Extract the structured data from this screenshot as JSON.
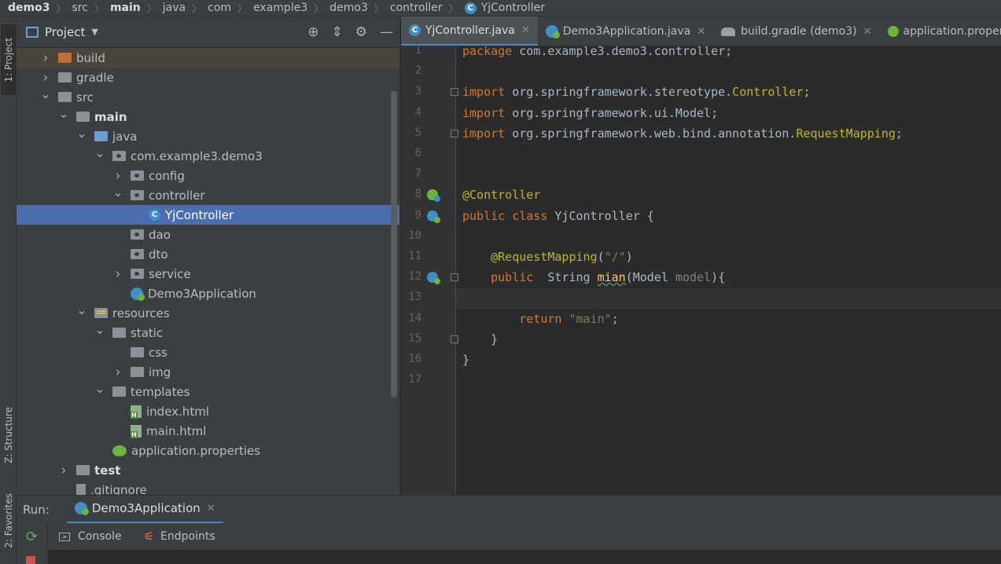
{
  "breadcrumb": [
    "demo3",
    "src",
    "main",
    "java",
    "com",
    "example3",
    "demo3",
    "controller",
    "YjController"
  ],
  "left_stripe": {
    "project": "1: Project",
    "structure": "Z: Structure",
    "favorites": "2: Favorites"
  },
  "project_panel": {
    "title": "Project",
    "tree": [
      {
        "label": "build",
        "indent": 0,
        "chev": "right",
        "icon": "folder-orange"
      },
      {
        "label": "gradle",
        "indent": 0,
        "chev": "right",
        "icon": "folder"
      },
      {
        "label": "src",
        "indent": 0,
        "chev": "down",
        "icon": "folder"
      },
      {
        "label": "main",
        "indent": 1,
        "chev": "down",
        "icon": "folder-src",
        "bold": true
      },
      {
        "label": "java",
        "indent": 2,
        "chev": "down",
        "icon": "folder-blue"
      },
      {
        "label": "com.example3.demo3",
        "indent": 3,
        "chev": "down",
        "icon": "package"
      },
      {
        "label": "config",
        "indent": 4,
        "chev": "right",
        "icon": "package"
      },
      {
        "label": "controller",
        "indent": 4,
        "chev": "down",
        "icon": "package"
      },
      {
        "label": "YjController",
        "indent": 5,
        "chev": "none",
        "icon": "class",
        "selected": true
      },
      {
        "label": "dao",
        "indent": 4,
        "chev": "none",
        "icon": "package"
      },
      {
        "label": "dto",
        "indent": 4,
        "chev": "none",
        "icon": "package"
      },
      {
        "label": "service",
        "indent": 4,
        "chev": "right",
        "icon": "package"
      },
      {
        "label": "Demo3Application",
        "indent": 4,
        "chev": "none",
        "icon": "spring-class"
      },
      {
        "label": "resources",
        "indent": 2,
        "chev": "down",
        "icon": "folder-res"
      },
      {
        "label": "static",
        "indent": 3,
        "chev": "down",
        "icon": "folder"
      },
      {
        "label": "css",
        "indent": 4,
        "chev": "none",
        "icon": "folder"
      },
      {
        "label": "img",
        "indent": 4,
        "chev": "right",
        "icon": "folder"
      },
      {
        "label": "templates",
        "indent": 3,
        "chev": "down",
        "icon": "folder"
      },
      {
        "label": "index.html",
        "indent": 4,
        "chev": "none",
        "icon": "html"
      },
      {
        "label": "main.html",
        "indent": 4,
        "chev": "none",
        "icon": "html"
      },
      {
        "label": "application.properties",
        "indent": 3,
        "chev": "none",
        "icon": "properties"
      },
      {
        "label": "test",
        "indent": 1,
        "chev": "right",
        "icon": "folder-src",
        "bold": true
      },
      {
        "label": ".gitignore",
        "indent": 1,
        "chev": "none",
        "icon": "file"
      }
    ]
  },
  "editor_tabs": [
    {
      "label": "YjController.java",
      "icon": "class",
      "active": true
    },
    {
      "label": "Demo3Application.java",
      "icon": "spring-class"
    },
    {
      "label": "build.gradle (demo3)",
      "icon": "gradle"
    },
    {
      "label": "application.propert",
      "icon": "properties"
    }
  ],
  "code_lines": [
    {
      "n": "1",
      "html": "<span class='kw'>package</span> com.example3.demo3.controller;"
    },
    {
      "n": "2",
      "html": ""
    },
    {
      "n": "3",
      "html": "<span class='kw'>import</span> org.springframework.stereotype.<span class='typ'>Controller</span>;"
    },
    {
      "n": "4",
      "html": "<span class='kw'>import</span> org.springframework.ui.Model;"
    },
    {
      "n": "5",
      "html": "<span class='kw'>import</span> org.springframework.web.bind.annotation.<span class='typ'>RequestMapping</span>;"
    },
    {
      "n": "6",
      "html": ""
    },
    {
      "n": "7",
      "html": ""
    },
    {
      "n": "8",
      "html": "<span class='ann'>@Controller</span>"
    },
    {
      "n": "9",
      "html": "<span class='kw'>public class</span> YjController {"
    },
    {
      "n": "10",
      "html": ""
    },
    {
      "n": "11",
      "html": "    <span class='ann'>@RequestMapping</span>(<span class='str'>\"/\"</span>)"
    },
    {
      "n": "12",
      "html": "    <span class='kw'>public</span>  String <span class='fn'>mian</span>(Model <span class='muted'>model</span>){"
    },
    {
      "n": "13",
      "html": ""
    },
    {
      "n": "14",
      "html": "        <span class='kw'>return</span> <span class='str'>\"main\"</span>;"
    },
    {
      "n": "15",
      "html": "    }"
    },
    {
      "n": "16",
      "html": "}"
    },
    {
      "n": "17",
      "html": ""
    }
  ],
  "run_panel": {
    "label": "Run:",
    "tab": "Demo3Application",
    "console_tab": "Console",
    "endpoints_tab": "Endpoints"
  },
  "colors": {
    "accent": "#4a88c7",
    "selection": "#4b6eaf",
    "keyword": "#cc7832",
    "annotation": "#bbb529",
    "string": "#6a8759"
  }
}
